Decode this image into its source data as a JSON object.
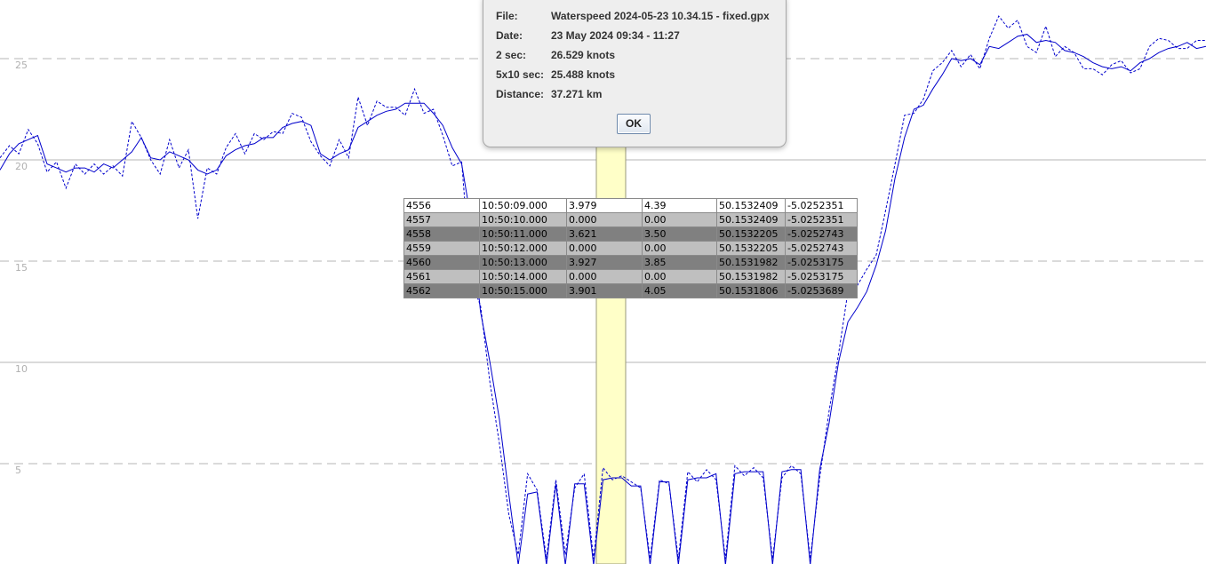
{
  "chart_data": {
    "type": "line",
    "y_ticks": [
      "25",
      "20",
      "15",
      "10",
      "5"
    ],
    "y_tick_values": [
      25,
      20,
      15,
      10,
      5
    ],
    "ylim": [
      0,
      27.5
    ],
    "grid": "horizontal dashed at each tick",
    "highlight_band_color": "#ffffc8",
    "series": [
      {
        "style": "solid",
        "color": "#0000cc",
        "values": [
          19.5,
          20.3,
          20.8,
          21.0,
          21.2,
          19.8,
          19.6,
          19.4,
          19.6,
          19.6,
          19.4,
          19.8,
          19.6,
          20.0,
          20.4,
          21.1,
          20.1,
          20.0,
          20.4,
          20.2,
          20.0,
          19.5,
          19.3,
          19.5,
          20.2,
          20.5,
          20.7,
          20.8,
          21.1,
          21.1,
          21.6,
          21.8,
          21.9,
          21.7,
          20.3,
          20.0,
          20.3,
          20.5,
          21.6,
          21.9,
          22.2,
          22.4,
          22.5,
          22.8,
          22.8,
          22.8,
          22.3,
          21.7,
          20.6,
          19.8,
          17.0,
          12.5,
          10.0,
          7.2,
          3.5,
          0.0,
          3.5,
          3.6,
          0.0,
          4.0,
          0.0,
          4.0,
          4.0,
          0.0,
          4.2,
          4.3,
          4.3,
          3.9,
          3.9,
          0.0,
          4.1,
          4.1,
          0.0,
          4.2,
          4.3,
          4.3,
          4.5,
          0.0,
          4.5,
          4.6,
          4.6,
          4.6,
          0.0,
          4.6,
          4.7,
          4.7,
          0.0,
          4.7,
          7.0,
          10.0,
          12.0,
          12.7,
          13.5,
          14.8,
          16.5,
          19.1,
          21.1,
          22.5,
          22.7,
          23.5,
          24.2,
          25.0,
          24.9,
          25.0,
          24.7,
          25.6,
          25.5,
          25.8,
          26.1,
          26.2,
          25.8,
          25.9,
          25.8,
          25.4,
          25.3,
          25.1,
          24.8,
          24.6,
          24.5,
          24.6,
          24.4,
          24.8,
          25.0,
          25.3,
          25.5,
          25.6,
          25.8,
          25.5,
          25.6
        ]
      },
      {
        "style": "dotted",
        "color": "#0000cc",
        "values": [
          20.1,
          20.7,
          20.3,
          21.5,
          20.8,
          19.4,
          19.9,
          18.6,
          19.8,
          19.3,
          19.8,
          19.3,
          19.7,
          19.2,
          21.9,
          21.1,
          20.0,
          19.3,
          21.0,
          19.6,
          20.5,
          17.1,
          19.6,
          19.3,
          20.6,
          21.3,
          20.3,
          21.3,
          21.0,
          21.4,
          21.3,
          22.3,
          22.1,
          20.9,
          20.2,
          19.7,
          21.0,
          20.1,
          23.1,
          21.7,
          22.9,
          22.6,
          22.6,
          22.2,
          23.5,
          22.3,
          22.5,
          21.2,
          19.7,
          19.9,
          14.0,
          12.8,
          9.0,
          6.0,
          2.5,
          0.5,
          4.5,
          3.7,
          0.3,
          4.2,
          0.5,
          3.8,
          4.5,
          0.3,
          4.8,
          4.2,
          4.4,
          4.1,
          3.8,
          0.3,
          4.2,
          4.0,
          0.3,
          4.6,
          4.1,
          4.7,
          4.2,
          0.3,
          4.9,
          4.4,
          4.8,
          4.3,
          0.3,
          4.3,
          4.9,
          4.5,
          0.3,
          4.3,
          7.6,
          10.4,
          13.5,
          13.8,
          14.6,
          15.3,
          17.5,
          19.8,
          22.2,
          22.3,
          23.0,
          24.4,
          24.8,
          25.4,
          24.6,
          25.2,
          24.5,
          26.0,
          27.1,
          26.5,
          26.9,
          25.6,
          25.3,
          26.6,
          25.1,
          25.6,
          25.3,
          24.5,
          24.5,
          24.2,
          24.7,
          24.9,
          24.3,
          24.5,
          25.6,
          26.0,
          25.9,
          25.5,
          25.5,
          25.9,
          25.9
        ]
      }
    ]
  },
  "dialog": {
    "rows": [
      {
        "key": "File:",
        "value": "Waterspeed 2024-05-23 10.34.15 - fixed.gpx"
      },
      {
        "key": "Date:",
        "value": "23 May 2024 09:34 - 11:27"
      },
      {
        "key": "2 sec:",
        "value": "26.529 knots"
      },
      {
        "key": "5x10 sec:",
        "value": "25.488 knots"
      },
      {
        "key": "Distance:",
        "value": "37.271 km"
      }
    ],
    "ok_label": "OK"
  },
  "table": {
    "rows": [
      [
        "4556",
        "10:50:09.000",
        "3.979",
        "4.39",
        "50.1532409",
        "-5.0252351"
      ],
      [
        "4557",
        "10:50:10.000",
        "0.000",
        "0.00",
        "50.1532409",
        "-5.0252351"
      ],
      [
        "4558",
        "10:50:11.000",
        "3.621",
        "3.50",
        "50.1532205",
        "-5.0252743"
      ],
      [
        "4559",
        "10:50:12.000",
        "0.000",
        "0.00",
        "50.1532205",
        "-5.0252743"
      ],
      [
        "4560",
        "10:50:13.000",
        "3.927",
        "3.85",
        "50.1531982",
        "-5.0253175"
      ],
      [
        "4561",
        "10:50:14.000",
        "0.000",
        "0.00",
        "50.1531982",
        "-5.0253175"
      ],
      [
        "4562",
        "10:50:15.000",
        "3.901",
        "4.05",
        "50.1531806",
        "-5.0253689"
      ]
    ]
  }
}
